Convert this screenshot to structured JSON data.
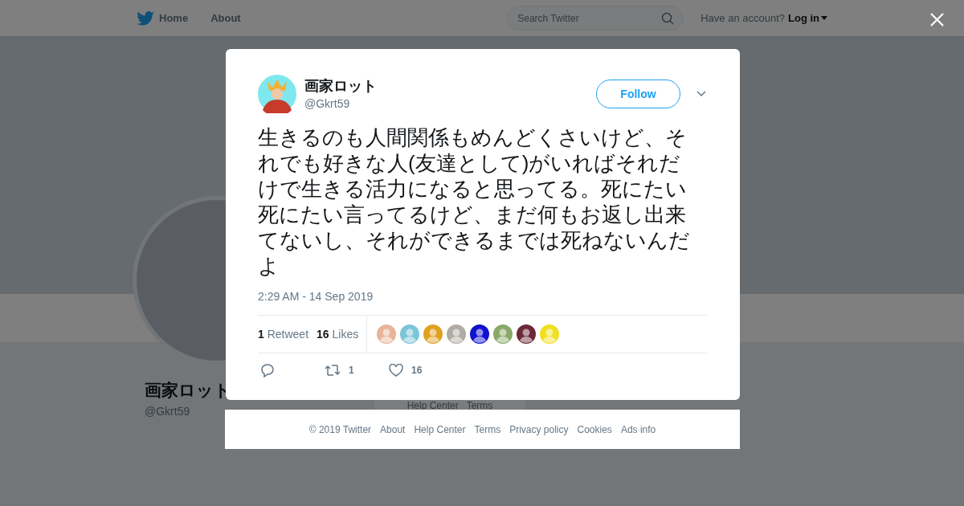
{
  "header": {
    "nav": [
      {
        "label": "Home",
        "selected": false
      },
      {
        "label": "About",
        "selected": false
      }
    ],
    "search": {
      "placeholder": "Search Twitter"
    },
    "account_prompt": "Have an account?",
    "login": "Log in"
  },
  "profile": {
    "name": "画家ロット",
    "handle": "@Gkrt59"
  },
  "background_footer": [
    "Help Center",
    "Terms"
  ],
  "tweet": {
    "author": {
      "name": "画家ロット",
      "handle": "@Gkrt59"
    },
    "follow_button": "Follow",
    "text": "生きるのも人間関係もめんどくさいけど、それでも好きな人(友達として)がいればそれだけで生きる活力になると思ってる。死にたい死にたい言ってるけど、まだ何もお返し出来てないし、それができるまでは死ねないんだよ",
    "timestamp": "2:29 AM - 14 Sep 2019",
    "stats": [
      {
        "count": "1",
        "label": "Retweet"
      },
      {
        "count": "16",
        "label": "Likes"
      }
    ],
    "liked_by": [
      {
        "color": "#e8b49a"
      },
      {
        "color": "#7cc4d8"
      },
      {
        "color": "#e0a020"
      },
      {
        "color": "#b0aca4"
      },
      {
        "color": "#1010d0"
      },
      {
        "color": "#8aa868"
      },
      {
        "color": "#6a2838"
      },
      {
        "color": "#f0e020"
      }
    ],
    "actions": [
      {
        "kind": "reply"
      },
      {
        "kind": "retweet",
        "count": "1"
      },
      {
        "kind": "like",
        "count": "16"
      }
    ]
  },
  "footer": [
    "© 2019 Twitter",
    "About",
    "Help Center",
    "Terms",
    "Privacy policy",
    "Cookies",
    "Ads info"
  ]
}
